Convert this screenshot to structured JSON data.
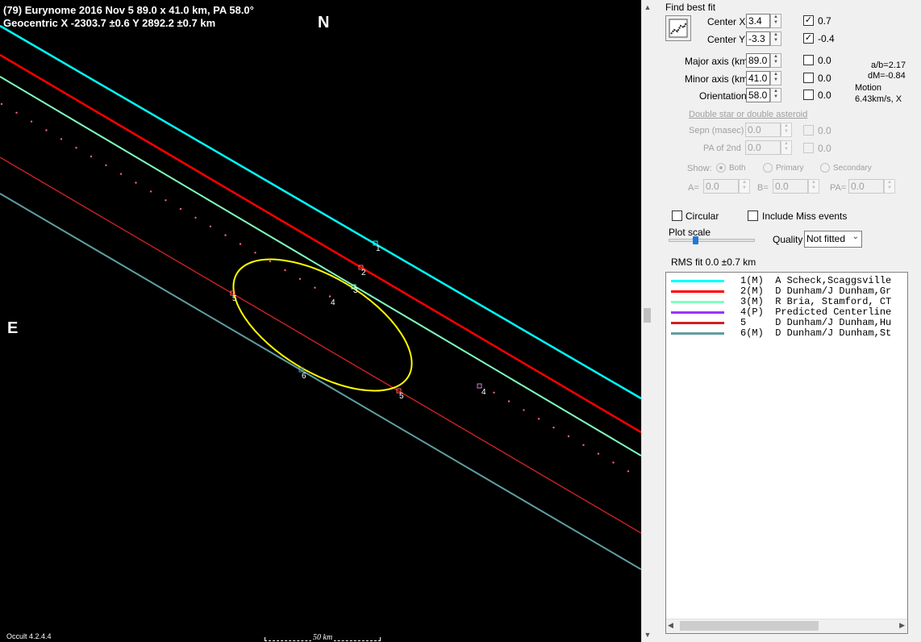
{
  "plot": {
    "title_line1": "(79) Eurynome  2016 Nov 5   89.0 x 41.0 km,  PA 58.0°",
    "title_line2": "Geocentric  X  -2303.7 ±0.6  Y 2892.2 ±0.7 km",
    "north": "N",
    "east": "E",
    "version": "Occult 4.2.4.4",
    "scale_label": "50 km",
    "chord_labels": [
      "1",
      "2",
      "3",
      "4",
      "4",
      "5",
      "5",
      "6"
    ]
  },
  "panel": {
    "find_best_fit": "Find best fit",
    "center_x": {
      "label": "Center X",
      "value": "3.4",
      "checked": true,
      "result": "0.7"
    },
    "center_y": {
      "label": "Center Y",
      "value": "-3.3",
      "checked": true,
      "result": "-0.4"
    },
    "major": {
      "label": "Major axis (km)",
      "value": "89.0",
      "checked": false,
      "result": "0.0"
    },
    "minor": {
      "label": "Minor axis (km)",
      "value": "41.0",
      "checked": false,
      "result": "0.0"
    },
    "orientation": {
      "label": "Orientation",
      "value": "58.0",
      "checked": false,
      "result": "0.0"
    },
    "ab_ratio": "a/b=2.17",
    "dm": "dM=-0.84",
    "motion_label": "Motion",
    "motion_value": "6.43km/s, X",
    "double_star_link": "Double star  or  double asteroid",
    "sepn": {
      "label": "Sepn (masec)",
      "value": "0.0",
      "result": "0.0"
    },
    "pa2nd": {
      "label": "PA of 2nd",
      "value": "0.0",
      "result": "0.0"
    },
    "show": {
      "label": "Show:",
      "options": [
        "Both",
        "Primary",
        "Secondary"
      ]
    },
    "a_field": {
      "label": "A=",
      "value": "0.0"
    },
    "b_field": {
      "label": "B=",
      "value": "0.0"
    },
    "pa_field": {
      "label": "PA=",
      "value": "0.0"
    },
    "circular": "Circular",
    "include_miss": "Include Miss events",
    "plot_scale": "Plot scale",
    "plot_scale_level": 0.3,
    "quality_label": "Quality",
    "quality_value": "Not fitted",
    "rms_fit": "RMS fit 0.0 ±0.7 km"
  },
  "legend": [
    {
      "text": "1(M)  A Scheck,Scaggsville",
      "color": "#00ffff"
    },
    {
      "text": "2(M)  D Dunham/J Dunham,Gr",
      "color": "#ff0000"
    },
    {
      "text": "3(M)  R Bria, Stamford, CT",
      "color": "#80ffc0"
    },
    {
      "text": "4(P)  Predicted Centerline",
      "color": "#9933ff"
    },
    {
      "text": "5     D Dunham/J Dunham,Hu",
      "color": "#cc2222"
    },
    {
      "text": "6(M)  D Dunham/J Dunham,St",
      "color": "#5f9ea0"
    }
  ],
  "colors": {
    "chord1": "#00ffff",
    "chord2": "#ff0000",
    "chord3": "#80ffc0",
    "chord5": "#c02020",
    "chord6": "#5f9ea0",
    "ellipse": "#ffff00",
    "centerline_dots": "#ff6080"
  }
}
